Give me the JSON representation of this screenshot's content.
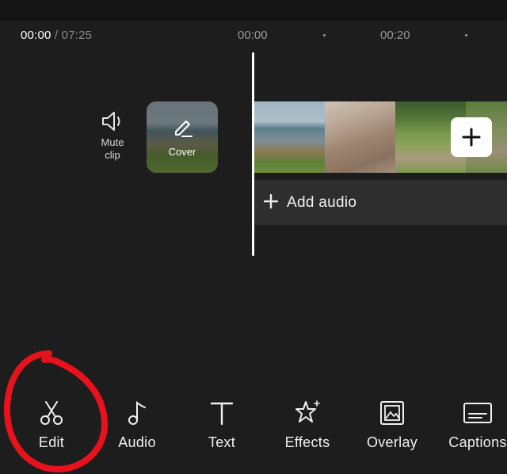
{
  "timeline": {
    "current_time": "00:00",
    "separator": "/",
    "duration": "07:25",
    "ruler_labels": [
      "00:00",
      "00:20"
    ]
  },
  "track": {
    "mute_label": "Mute clip",
    "cover_label": "Cover",
    "add_audio_label": "Add audio",
    "add_clip_icon": "plus-icon"
  },
  "toolbar": {
    "items": [
      {
        "label": "Edit",
        "icon": "scissors-icon"
      },
      {
        "label": "Audio",
        "icon": "music-note-icon"
      },
      {
        "label": "Text",
        "icon": "text-icon"
      },
      {
        "label": "Effects",
        "icon": "sparkle-star-icon"
      },
      {
        "label": "Overlay",
        "icon": "overlay-image-icon"
      },
      {
        "label": "Captions",
        "icon": "captions-icon"
      }
    ]
  },
  "colors": {
    "background": "#1d1d1d",
    "audio_track": "#2e2e2e",
    "annotation_red": "#e8121c"
  }
}
